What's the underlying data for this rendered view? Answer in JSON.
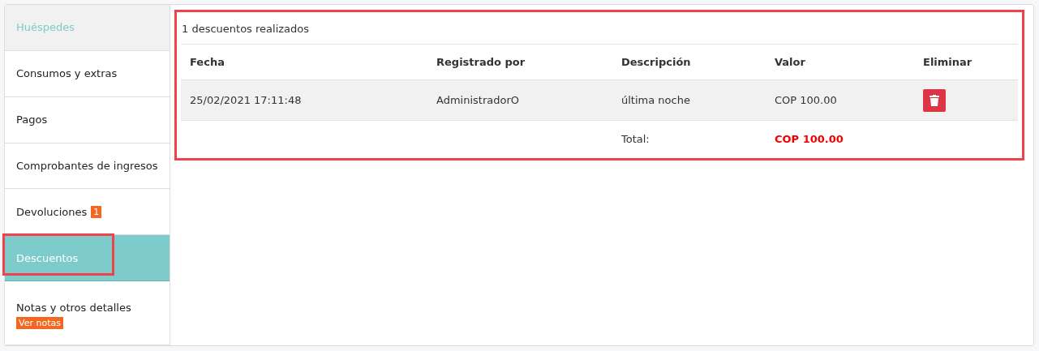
{
  "sidebar": {
    "items": [
      {
        "label": "Huéspedes",
        "kind": "header",
        "selected": false,
        "highlighted": false
      },
      {
        "label": "Consumos y extras",
        "kind": "link",
        "selected": false,
        "highlighted": false
      },
      {
        "label": "Pagos",
        "kind": "link",
        "selected": false,
        "highlighted": false
      },
      {
        "label": "Comprobantes de ingresos",
        "kind": "link",
        "selected": false,
        "highlighted": false
      },
      {
        "label": "Devoluciones",
        "kind": "link",
        "selected": false,
        "highlighted": false,
        "badge": {
          "text": "1",
          "kind": "inline"
        }
      },
      {
        "label": "Descuentos",
        "kind": "link",
        "selected": true,
        "highlighted": true
      },
      {
        "label": "Notas y otros detalles",
        "kind": "link",
        "selected": false,
        "highlighted": false,
        "badge": {
          "text": "Ver notas",
          "kind": "below"
        }
      }
    ]
  },
  "content": {
    "highlighted": true,
    "summary": "1 descuentos realizados",
    "table": {
      "columns": [
        "Fecha",
        "Registrado por",
        "Descripción",
        "Valor",
        "Eliminar"
      ],
      "rows": [
        {
          "fecha": "25/02/2021 17:11:48",
          "registrado_por": "AdministradorO",
          "descripcion": "última noche",
          "valor": "COP 100.00"
        }
      ],
      "total": {
        "label": "Total:",
        "value": "COP 100.00"
      }
    }
  }
}
